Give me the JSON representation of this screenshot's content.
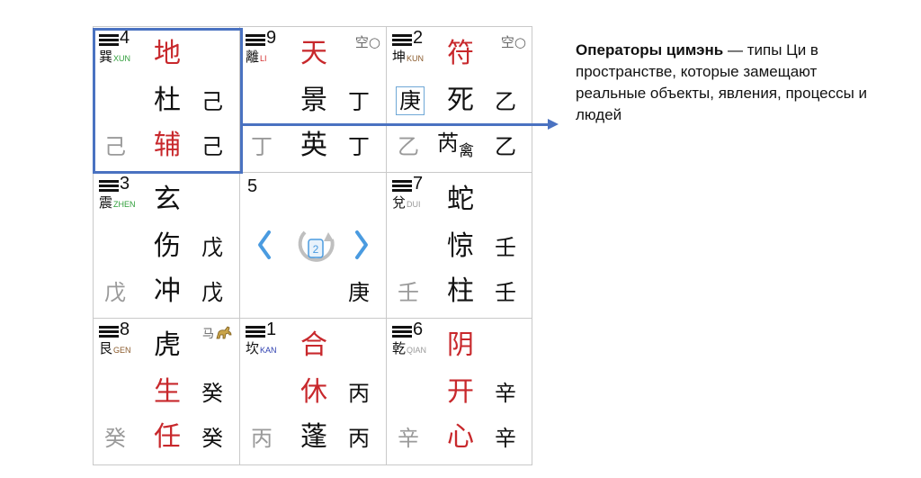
{
  "caption": {
    "bold": "Операторы цимэнь",
    "rest": " — типы Ци в пространстве, которые замещают реальные объекты, явления, процессы и людей"
  },
  "colors": {
    "highlight": "#4a72c1",
    "red": "#c8282c",
    "grey": "#9a9a9a",
    "box": "#6fa8d6"
  },
  "palaces": {
    "xun": {
      "num": "4",
      "name": "巽",
      "pinyin": "XUN",
      "pinyin_color": "#2f9e3a",
      "deity": "地",
      "door": "杜",
      "star": "辅",
      "heaven": "己",
      "earth": "己",
      "left": "己"
    },
    "li": {
      "num": "9",
      "name": "離",
      "pinyin": "LI",
      "pinyin_color": "#d53030",
      "deity": "天",
      "door": "景",
      "star": "英",
      "heaven": "丁",
      "earth": "丁",
      "left": "丁",
      "void": "空○"
    },
    "kun": {
      "num": "2",
      "name": "坤",
      "pinyin": "KUN",
      "pinyin_color": "#8a5a2b",
      "deity": "符",
      "door": "死",
      "star": "芮",
      "star2": "禽",
      "heaven": "乙",
      "earth": "乙",
      "left": "乙",
      "boxed": "庚",
      "void": "空○"
    },
    "zhen": {
      "num": "3",
      "name": "震",
      "pinyin": "ZHEN",
      "pinyin_color": "#2f9e3a",
      "deity": "玄",
      "door": "伤",
      "star": "冲",
      "heaven": "戊",
      "earth": "戊",
      "left": "戊"
    },
    "center": {
      "num": "5",
      "earth": "庚",
      "badge": "2"
    },
    "dui": {
      "num": "7",
      "name": "兌",
      "pinyin": "DUI",
      "pinyin_color": "#9a9a9a",
      "deity": "蛇",
      "door": "惊",
      "star": "柱",
      "heaven": "壬",
      "earth": "壬",
      "left": "壬"
    },
    "gen": {
      "num": "8",
      "name": "艮",
      "pinyin": "GEN",
      "pinyin_color": "#8a5a2b",
      "deity": "虎",
      "door": "生",
      "star": "任",
      "heaven": "癸",
      "earth": "癸",
      "left": "癸",
      "horse": "马"
    },
    "kan": {
      "num": "1",
      "name": "坎",
      "pinyin": "KAN",
      "pinyin_color": "#2d3fb0",
      "deity": "合",
      "door": "休",
      "star": "蓬",
      "heaven": "丙",
      "earth": "丙",
      "left": "丙"
    },
    "qian": {
      "num": "6",
      "name": "乾",
      "pinyin": "QIAN",
      "pinyin_color": "#9a9a9a",
      "deity": "阴",
      "door": "开",
      "star": "心",
      "heaven": "辛",
      "earth": "辛",
      "left": "辛"
    }
  }
}
